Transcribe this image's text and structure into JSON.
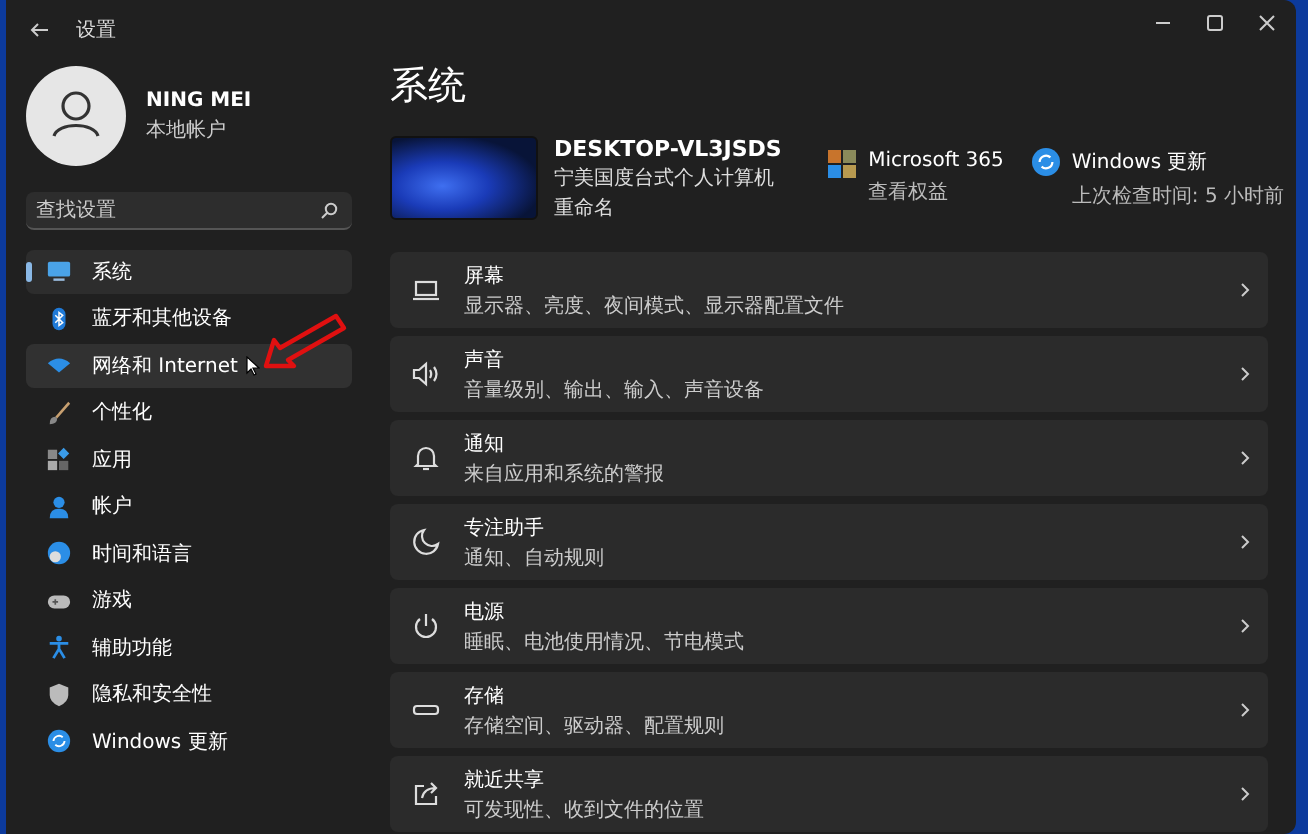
{
  "window": {
    "title": "设置"
  },
  "account": {
    "name": "NING MEI",
    "type": "本地帐户"
  },
  "search": {
    "placeholder": "查找设置"
  },
  "nav": [
    {
      "label": "系统",
      "selected": true,
      "hovered": false
    },
    {
      "label": "蓝牙和其他设备",
      "selected": false,
      "hovered": false
    },
    {
      "label": "网络和 Internet",
      "selected": false,
      "hovered": true
    },
    {
      "label": "个性化",
      "selected": false,
      "hovered": false
    },
    {
      "label": "应用",
      "selected": false,
      "hovered": false
    },
    {
      "label": "帐户",
      "selected": false,
      "hovered": false
    },
    {
      "label": "时间和语言",
      "selected": false,
      "hovered": false
    },
    {
      "label": "游戏",
      "selected": false,
      "hovered": false
    },
    {
      "label": "辅助功能",
      "selected": false,
      "hovered": false
    },
    {
      "label": "隐私和安全性",
      "selected": false,
      "hovered": false
    },
    {
      "label": "Windows 更新",
      "selected": false,
      "hovered": false
    }
  ],
  "page_title": "系统",
  "device": {
    "name": "DESKTOP-VL3JSDS",
    "model": "宁美国度台式个人计算机",
    "rename": "重命名"
  },
  "quick_links": [
    {
      "title": "Microsoft 365",
      "subtitle": "查看权益"
    },
    {
      "title": "Windows 更新",
      "subtitle": "上次检查时间: 5 小时前"
    }
  ],
  "cards": [
    {
      "title": "屏幕",
      "subtitle": "显示器、亮度、夜间模式、显示器配置文件"
    },
    {
      "title": "声音",
      "subtitle": "音量级别、输出、输入、声音设备"
    },
    {
      "title": "通知",
      "subtitle": "来自应用和系统的警报"
    },
    {
      "title": "专注助手",
      "subtitle": "通知、自动规则"
    },
    {
      "title": "电源",
      "subtitle": "睡眠、电池使用情况、节电模式"
    },
    {
      "title": "存储",
      "subtitle": "存储空间、驱动器、配置规则"
    },
    {
      "title": "就近共享",
      "subtitle": "可发现性、收到文件的位置"
    }
  ]
}
